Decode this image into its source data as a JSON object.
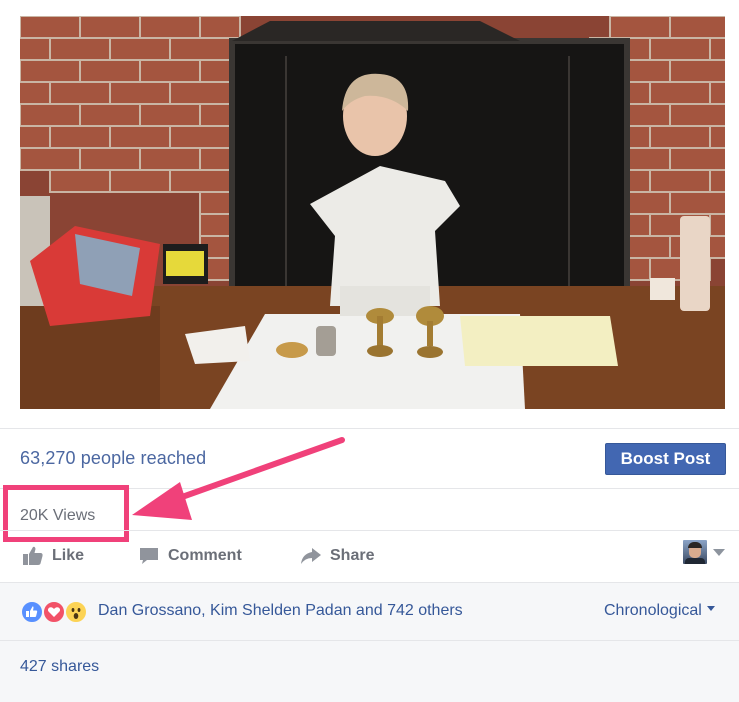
{
  "post": {
    "reach_text": "63,270 people reached",
    "boost_label": "Boost Post",
    "views_text": "20K Views"
  },
  "actions": {
    "like_label": "Like",
    "comment_label": "Comment",
    "share_label": "Share"
  },
  "feedback": {
    "reactors_text": "Dan Grossano, Kim Shelden Padan and 742 others",
    "sort_label": "Chronological",
    "shares_text": "427 shares"
  },
  "colors": {
    "link_blue": "#365899",
    "boost_blue": "#4267b2",
    "highlight_pink": "#f0417a",
    "muted_gray": "#6b6f78"
  },
  "icons": {
    "like": "thumbs-up-icon",
    "comment": "comment-bubble-icon",
    "share": "share-arrow-icon",
    "reactions": [
      "like-reaction-icon",
      "love-reaction-icon",
      "wow-reaction-icon"
    ]
  }
}
